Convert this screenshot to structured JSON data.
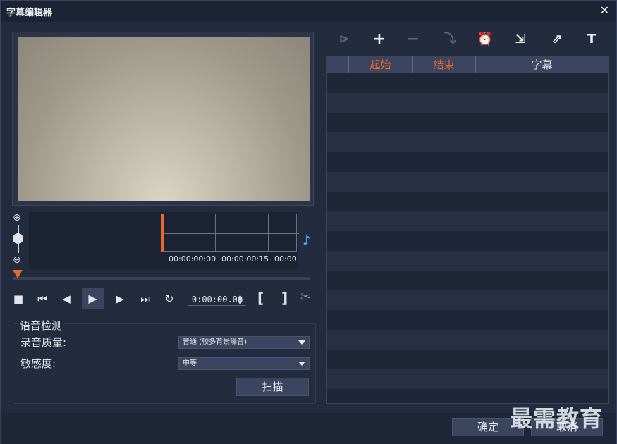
{
  "window": {
    "title": "字幕编辑器",
    "close_icon": "close-icon"
  },
  "timeline": {
    "time_labels": [
      "00:00:00:00",
      "00:00:00:15",
      "00:00:0"
    ],
    "zoom_in_icon": "zoom-in-icon",
    "zoom_out_icon": "zoom-out-icon",
    "audio_icon": "audio-waveform-icon"
  },
  "transport": {
    "timecode": "0:00:00.00",
    "buttons": [
      "stop",
      "previous",
      "step-back",
      "play",
      "step-forward",
      "next",
      "repeat"
    ],
    "mark_in": "[",
    "mark_out": "]"
  },
  "speech_detection": {
    "title": "语音检测",
    "quality_label": "录音质量:",
    "quality_value": "普通 (较多背景噪音)",
    "sensitivity_label": "敏感度:",
    "sensitivity_value": "中等",
    "scan_label": "扫描"
  },
  "subtitle_table": {
    "columns": [
      "",
      "起始",
      "结束",
      "字幕"
    ],
    "header_accent": "#e8692b"
  },
  "toolbar": {
    "icons": [
      "play-subtitle-icon",
      "add-icon",
      "remove-icon",
      "merge-icon",
      "time-offset-icon",
      "import-icon",
      "export-icon",
      "text-format-icon"
    ]
  },
  "footer": {
    "ok_label": "确定",
    "cancel_label": "取消"
  },
  "watermark": "最需教育"
}
